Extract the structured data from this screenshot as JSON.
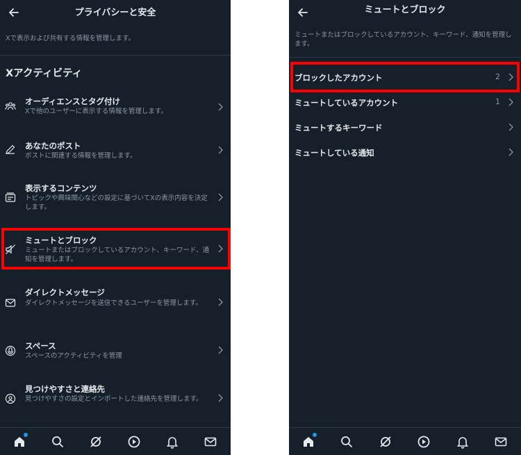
{
  "left": {
    "title": "プライバシーと安全",
    "description": "Xで表示および共有する情報を管理します。",
    "section_title": "Xアクティビティ",
    "items": [
      {
        "title": "オーディエンスとタグ付け",
        "sub": "Xで他のユーザーに表示する情報を管理します。",
        "icon": "people-icon"
      },
      {
        "title": "あなたのポスト",
        "sub": "ポストに関連する情報を管理します。",
        "icon": "pencil-icon"
      },
      {
        "title": "表示するコンテンツ",
        "sub": "トピックや興味関心などの設定に基づいてXの表示内容を決定します。",
        "icon": "content-icon"
      },
      {
        "title": "ミュートとブロック",
        "sub": "ミュートまたはブロックしているアカウント、キーワード、通知を管理します。",
        "icon": "mute-icon"
      },
      {
        "title": "ダイレクトメッセージ",
        "sub": "ダイレクトメッセージを送信できるユーザーを管理します。",
        "icon": "mail-icon"
      },
      {
        "title": "スペース",
        "sub": "スペースのアクティビティを管理",
        "icon": "spaces-icon"
      },
      {
        "title": "見つけやすさと連絡先",
        "sub": "見つけやすさの設定とインポートした連絡先を管理します。",
        "icon": "discover-icon"
      }
    ]
  },
  "right": {
    "title": "ミュートとブロック",
    "description": "ミュートまたはブロックしているアカウント、キーワード、通知を管理します。",
    "items": [
      {
        "title": "ブロックしたアカウント",
        "count": "2"
      },
      {
        "title": "ミュートしているアカウント",
        "count": "1"
      },
      {
        "title": "ミュートするキーワード",
        "count": ""
      },
      {
        "title": "ミュートしている通知",
        "count": ""
      }
    ]
  },
  "tabs": [
    "home-icon",
    "search-icon",
    "grok-icon",
    "play-icon",
    "bell-icon",
    "mail-icon"
  ],
  "colors": {
    "background": "#15202b",
    "text": "#e7e9ea",
    "secondary": "#8b98a5",
    "accent": "#1d9bf0",
    "highlight": "#ff0000"
  }
}
